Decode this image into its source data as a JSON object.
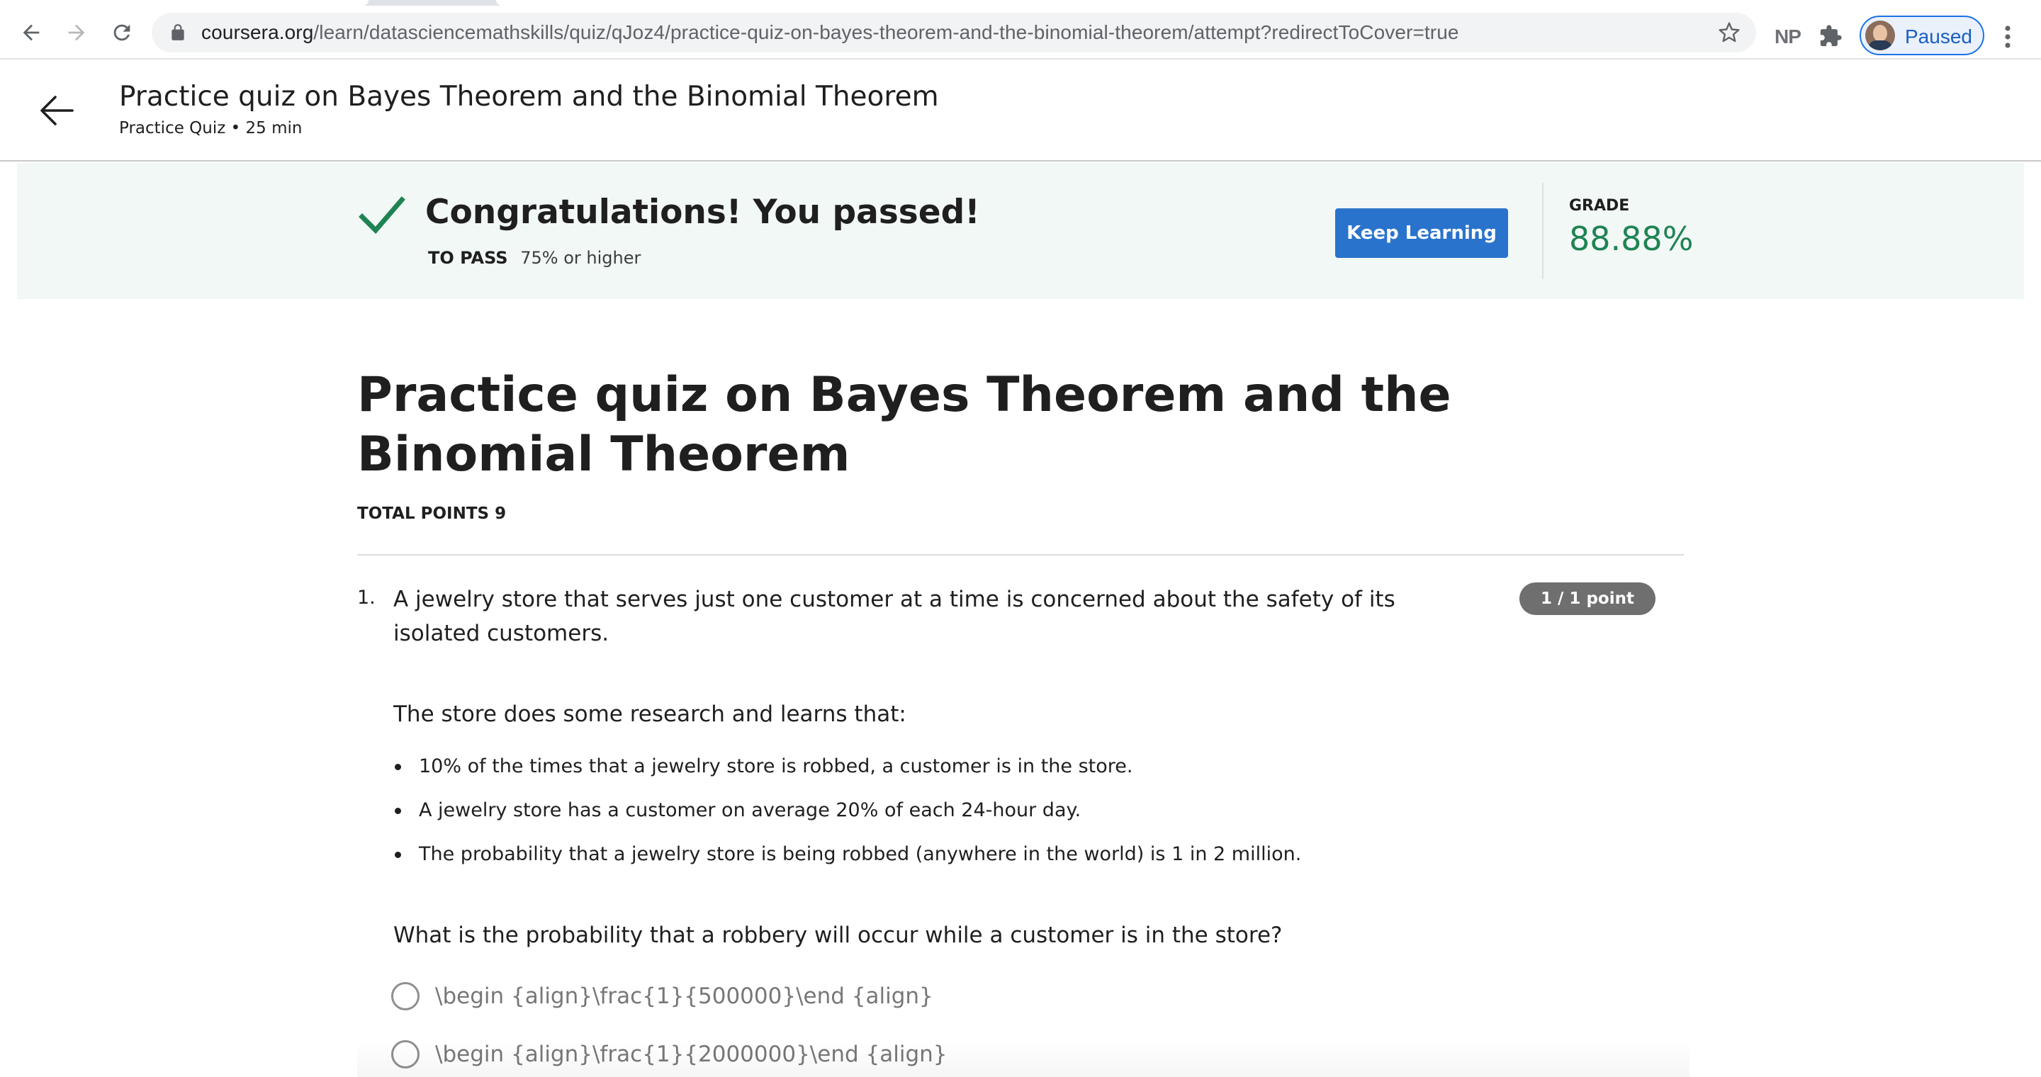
{
  "browser": {
    "url_host": "coursera.org",
    "url_path": "/learn/datasciencemathskills/quiz/qJoz4/practice-quiz-on-bayes-theorem-and-the-binomial-theorem/attempt?redirectToCover=true",
    "extension_label": "NP",
    "profile_label": "Paused",
    "icons": {
      "back": "back-arrow-icon",
      "forward": "forward-arrow-icon",
      "reload": "reload-icon",
      "lock": "lock-icon",
      "bookmark": "star-icon",
      "extensions": "puzzle-icon",
      "menu": "kebab-menu-icon"
    }
  },
  "header": {
    "title": "Practice quiz on Bayes Theorem and the Binomial Theorem",
    "subtitle": "Practice Quiz • 25 min"
  },
  "banner": {
    "message": "Congratulations! You passed!",
    "to_pass_label": "TO PASS",
    "to_pass_value": "75% or higher",
    "button_label": "Keep Learning",
    "grade_label": "GRADE",
    "grade_value": "88.88%",
    "colors": {
      "background": "#f2f8f6",
      "accent_green": "#1f8354",
      "button_blue": "#2a73cc"
    }
  },
  "quiz": {
    "title": "Practice quiz on Bayes Theorem and the Binomial Theorem",
    "total_points": "TOTAL POINTS 9",
    "question": {
      "number": "1.",
      "text": "A jewelry store that serves just one customer at a time is concerned about the safety of its isolated customers.",
      "points_badge": "1 / 1 point",
      "research_intro": "The store does some research and learns that:",
      "facts": [
        "10% of the times that a jewelry store is robbed, a customer is in the store.",
        "A jewelry store has a customer on average 20% of each 24-hour day.",
        "The probability that a jewelry store is being robbed (anywhere in the world) is 1 in 2 million."
      ],
      "prompt": "What is the probability that a robbery will occur while a customer is in the store?",
      "options": [
        "\\begin {align}\\frac{1}{500000}\\end {align}",
        "\\begin {align}\\frac{1}{2000000}\\end {align}"
      ]
    }
  }
}
